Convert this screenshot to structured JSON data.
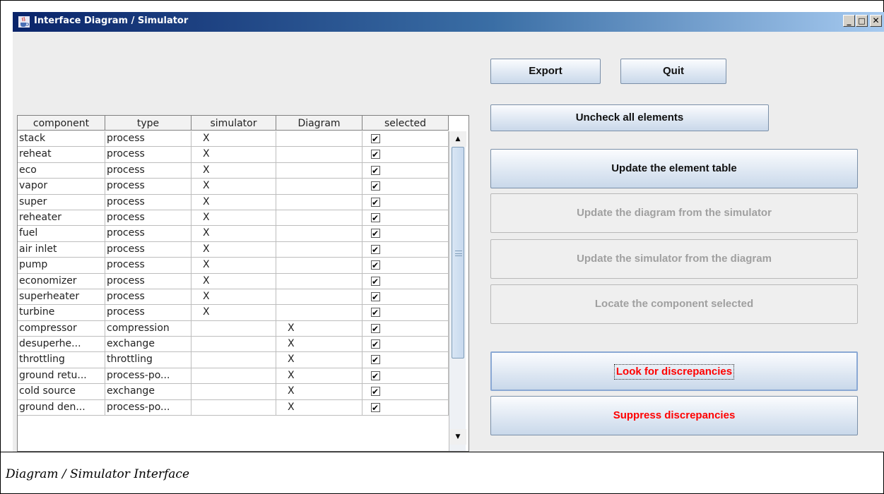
{
  "window": {
    "title": "Interface Diagram / Simulator",
    "controls": {
      "minimize": "_",
      "maximize": "□",
      "close": "✕"
    }
  },
  "table": {
    "headers": [
      "component",
      "type",
      "simulator",
      "Diagram",
      "selected"
    ],
    "rows": [
      {
        "component": "stack",
        "type": "process",
        "simulator": "X",
        "diagram": "",
        "selected": true
      },
      {
        "component": "reheat",
        "type": "process",
        "simulator": "X",
        "diagram": "",
        "selected": true
      },
      {
        "component": "eco",
        "type": "process",
        "simulator": "X",
        "diagram": "",
        "selected": true
      },
      {
        "component": "vapor",
        "type": "process",
        "simulator": "X",
        "diagram": "",
        "selected": true
      },
      {
        "component": "super",
        "type": "process",
        "simulator": "X",
        "diagram": "",
        "selected": true
      },
      {
        "component": "reheater",
        "type": "process",
        "simulator": "X",
        "diagram": "",
        "selected": true
      },
      {
        "component": "fuel",
        "type": "process",
        "simulator": "X",
        "diagram": "",
        "selected": true
      },
      {
        "component": "air inlet",
        "type": "process",
        "simulator": "X",
        "diagram": "",
        "selected": true
      },
      {
        "component": "pump",
        "type": "process",
        "simulator": "X",
        "diagram": "",
        "selected": true
      },
      {
        "component": "economizer",
        "type": "process",
        "simulator": "X",
        "diagram": "",
        "selected": true
      },
      {
        "component": "superheater",
        "type": "process",
        "simulator": "X",
        "diagram": "",
        "selected": true
      },
      {
        "component": "turbine",
        "type": "process",
        "simulator": "X",
        "diagram": "",
        "selected": true
      },
      {
        "component": "compressor",
        "type": "compression",
        "simulator": "",
        "diagram": "X",
        "selected": true
      },
      {
        "component": "desuperhe...",
        "type": "exchange",
        "simulator": "",
        "diagram": "X",
        "selected": true
      },
      {
        "component": "throttling",
        "type": "throttling",
        "simulator": "",
        "diagram": "X",
        "selected": true
      },
      {
        "component": "ground retu...",
        "type": "process-po...",
        "simulator": "",
        "diagram": "X",
        "selected": true
      },
      {
        "component": "cold source",
        "type": "exchange",
        "simulator": "",
        "diagram": "X",
        "selected": true
      },
      {
        "component": "ground den...",
        "type": "process-po...",
        "simulator": "",
        "diagram": "X",
        "selected": true
      }
    ]
  },
  "buttons": {
    "export": "Export",
    "quit": "Quit",
    "uncheck_all": "Uncheck all elements",
    "update_table": "Update the element table",
    "update_diagram": "Update the diagram from the simulator",
    "update_simulator": "Update the simulator from the diagram",
    "locate": "Locate the component selected",
    "look_discrepancies": "Look for discrepancies",
    "suppress_discrepancies": "Suppress discrepancies"
  },
  "caption": "Diagram / Simulator Interface",
  "colors": {
    "titlebar_start": "#0a246a",
    "titlebar_end": "#a6caf0",
    "discrepancy_text": "#ff0000",
    "disabled_text": "#a0a0a0"
  }
}
